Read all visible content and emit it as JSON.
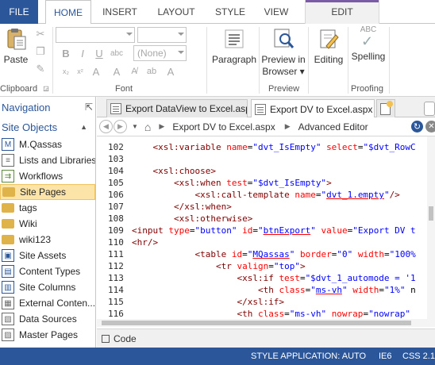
{
  "ribbon_tabs": {
    "file": "FILE",
    "home": "HOME",
    "insert": "INSERT",
    "layout": "LAYOUT",
    "style": "STYLE",
    "view": "VIEW",
    "edit": "EDIT"
  },
  "ribbon": {
    "paste_label": "Paste",
    "clipboard_label": "Clipboard",
    "font_label": "Font",
    "font_size_value": "(None)",
    "bold": "B",
    "italic": "I",
    "underline": "U",
    "paragraph_label": "Paragraph",
    "preview_btn_line1": "Preview in",
    "preview_btn_line2": "Browser",
    "preview_group_label": "Preview",
    "editing_label": "Editing",
    "spelling_label": "Spelling",
    "proofing_label": "Proofing",
    "abc_label": "ABC"
  },
  "nav": {
    "title": "Navigation",
    "section": "Site Objects",
    "items": [
      {
        "label": "M.Qassas",
        "icon": "site-icon"
      },
      {
        "label": "Lists and Libraries",
        "icon": "list-icon"
      },
      {
        "label": "Workflows",
        "icon": "workflow-icon"
      },
      {
        "label": "Site Pages",
        "icon": "folder-icon",
        "selected": true
      },
      {
        "label": "tags",
        "icon": "folder-icon"
      },
      {
        "label": "Wiki",
        "icon": "folder-icon"
      },
      {
        "label": "wiki123",
        "icon": "folder-icon"
      },
      {
        "label": "Site Assets",
        "icon": "assets-icon"
      },
      {
        "label": "Content Types",
        "icon": "content-types-icon"
      },
      {
        "label": "Site Columns",
        "icon": "columns-icon"
      },
      {
        "label": "External Conten...",
        "icon": "external-icon"
      },
      {
        "label": "Data Sources",
        "icon": "data-sources-icon"
      },
      {
        "label": "Master Pages",
        "icon": "master-pages-icon"
      }
    ]
  },
  "doc_tabs": [
    {
      "label": "Export DataView to Excel.aspx"
    },
    {
      "label": "Export DV to Excel.aspx *"
    }
  ],
  "breadcrumb": {
    "page": "Export DV to Excel.aspx",
    "mode": "Advanced Editor"
  },
  "code_lines": [
    {
      "n": "102",
      "parts": [
        [
          "pl",
          "    "
        ],
        [
          "tg",
          "<xsl:variable "
        ],
        [
          "at",
          "name"
        ],
        [
          "pl",
          "="
        ],
        [
          "vl",
          "\"dvt_IsEmpty\""
        ],
        [
          "pl",
          " "
        ],
        [
          "at",
          "select"
        ],
        [
          "pl",
          "="
        ],
        [
          "vl",
          "\"$dvt_RowC"
        ]
      ]
    },
    {
      "n": "103",
      "parts": []
    },
    {
      "n": "104",
      "parts": [
        [
          "pl",
          "    "
        ],
        [
          "tg",
          "<xsl:choose>"
        ]
      ]
    },
    {
      "n": "105",
      "parts": [
        [
          "pl",
          "        "
        ],
        [
          "tg",
          "<xsl:when "
        ],
        [
          "at",
          "test"
        ],
        [
          "pl",
          "="
        ],
        [
          "vl",
          "\"$dvt_IsEmpty\""
        ],
        [
          "tg",
          ">"
        ]
      ]
    },
    {
      "n": "106",
      "parts": [
        [
          "pl",
          "            "
        ],
        [
          "tg",
          "<xsl:call-template "
        ],
        [
          "at",
          "name"
        ],
        [
          "pl",
          "="
        ],
        [
          "vl",
          "\""
        ],
        [
          "vlu",
          "dvt_1.empty"
        ],
        [
          "vl",
          "\""
        ],
        [
          "tg",
          "/>"
        ]
      ]
    },
    {
      "n": "107",
      "parts": [
        [
          "pl",
          "        "
        ],
        [
          "tg",
          "</xsl:when>"
        ]
      ]
    },
    {
      "n": "108",
      "parts": [
        [
          "pl",
          "        "
        ],
        [
          "tg",
          "<xsl:otherwise>"
        ]
      ]
    },
    {
      "n": "109",
      "parts": [
        [
          "tg",
          "<input "
        ],
        [
          "at",
          "type"
        ],
        [
          "pl",
          "="
        ],
        [
          "vl",
          "\"button\""
        ],
        [
          "pl",
          " "
        ],
        [
          "at",
          "id"
        ],
        [
          "pl",
          "="
        ],
        [
          "vl",
          "\""
        ],
        [
          "vlu",
          "btnExport"
        ],
        [
          "vl",
          "\""
        ],
        [
          "pl",
          " "
        ],
        [
          "at",
          "value"
        ],
        [
          "pl",
          "="
        ],
        [
          "vl",
          "\"Export DV t"
        ]
      ]
    },
    {
      "n": "110",
      "parts": [
        [
          "tg",
          "<hr/>"
        ]
      ]
    },
    {
      "n": "111",
      "parts": [
        [
          "pl",
          "            "
        ],
        [
          "tg",
          "<table "
        ],
        [
          "at",
          "id"
        ],
        [
          "pl",
          "="
        ],
        [
          "vl",
          "\""
        ],
        [
          "vlu",
          "MQassas"
        ],
        [
          "vl",
          "\""
        ],
        [
          "pl",
          " "
        ],
        [
          "at",
          "border"
        ],
        [
          "pl",
          "="
        ],
        [
          "vl",
          "\"0\""
        ],
        [
          "pl",
          " "
        ],
        [
          "at",
          "width"
        ],
        [
          "pl",
          "="
        ],
        [
          "vl",
          "\"100%"
        ]
      ]
    },
    {
      "n": "112",
      "parts": [
        [
          "pl",
          "                "
        ],
        [
          "tg",
          "<tr "
        ],
        [
          "at",
          "valign"
        ],
        [
          "pl",
          "="
        ],
        [
          "vl",
          "\"top\""
        ],
        [
          "tg",
          ">"
        ]
      ]
    },
    {
      "n": "113",
      "parts": [
        [
          "pl",
          "                    "
        ],
        [
          "tg",
          "<xsl:if "
        ],
        [
          "at",
          "test"
        ],
        [
          "pl",
          "="
        ],
        [
          "vl",
          "\"$dvt_1_automode = '1"
        ]
      ]
    },
    {
      "n": "114",
      "parts": [
        [
          "pl",
          "                        "
        ],
        [
          "tg",
          "<th "
        ],
        [
          "at",
          "class"
        ],
        [
          "pl",
          "="
        ],
        [
          "vl",
          "\""
        ],
        [
          "vlu",
          "ms-vh"
        ],
        [
          "vl",
          "\""
        ],
        [
          "pl",
          " "
        ],
        [
          "at",
          "width"
        ],
        [
          "pl",
          "="
        ],
        [
          "vl",
          "\"1%\""
        ],
        [
          "pl",
          " n"
        ]
      ]
    },
    {
      "n": "115",
      "parts": [
        [
          "pl",
          "                    "
        ],
        [
          "tg",
          "</xsl:if>"
        ]
      ]
    },
    {
      "n": "116",
      "parts": [
        [
          "pl",
          "                    "
        ],
        [
          "tg",
          "<th "
        ],
        [
          "at",
          "class"
        ],
        [
          "pl",
          "="
        ],
        [
          "vl",
          "\"ms-vh\""
        ],
        [
          "pl",
          " "
        ],
        [
          "at",
          "nowrap"
        ],
        [
          "pl",
          "="
        ],
        [
          "vl",
          "\"nowrap\""
        ]
      ]
    }
  ],
  "code_bar_label": "Code",
  "status": {
    "style_app": "STYLE APPLICATION: AUTO",
    "browser": "IE6",
    "css": "CSS 2.1"
  },
  "colors": {
    "accent": "#2b579a",
    "selected_bg": "#fce4a8",
    "xml_tag": "#800000",
    "xml_attr": "#ff0000",
    "xml_value": "#0000ff"
  }
}
